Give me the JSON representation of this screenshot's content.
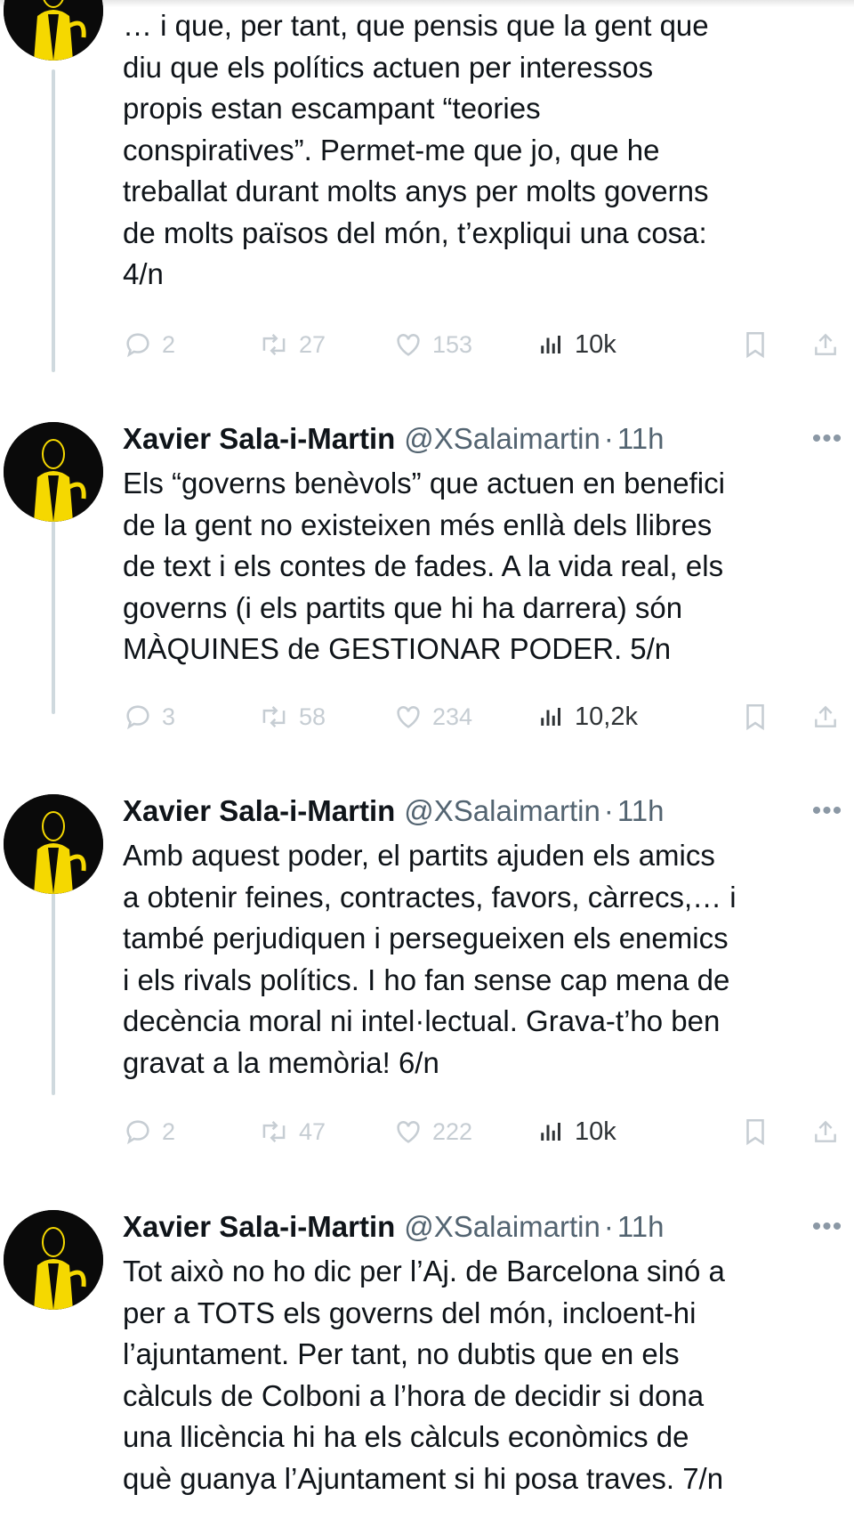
{
  "author": {
    "name": "Xavier Sala-i-Martin",
    "handle": "@XSalaimartin",
    "separator": "·",
    "time": "11h"
  },
  "colors": {
    "avatar_background": "#0a0a0a",
    "avatar_jacket": "#f5d800",
    "muted_text": "#536471",
    "faded_icon": "#c6cdd3",
    "thread_line": "#cfd9de"
  },
  "more_label": "•••",
  "tweets": [
    {
      "show_header": false,
      "text": "… i que, per tant, que pensis que la gent que\ndiu que els polítics actuen per interessos\npropis estan escampant “teories\nconspiratives”. Permet-me que jo, que he\ntreballat durant molts anys per molts governs\nde molts països del món, t’expliqui una cosa:\n4/n",
      "replies": "2",
      "reposts": "27",
      "likes": "153",
      "views": "10k"
    },
    {
      "show_header": true,
      "text": "Els “governs benèvols” que actuen en benefici\nde la gent no existeixen més enllà dels llibres\nde text i els contes de fades. A la vida real, els\ngoverns (i els partits que hi ha darrera) són\nMÀQUINES de GESTIONAR PODER. 5/n",
      "replies": "3",
      "reposts": "58",
      "likes": "234",
      "views": "10,2k"
    },
    {
      "show_header": true,
      "text": "Amb aquest poder, el partits ajuden els amics\na obtenir feines, contractes, favors, càrrecs,… i\ntambé perjudiquen i persegueixen els enemics\ni els rivals polítics. I ho fan sense cap mena de\ndecència moral ni intel·lectual. Grava-t’ho ben\ngravat a la memòria! 6/n",
      "replies": "2",
      "reposts": "47",
      "likes": "222",
      "views": "10k"
    },
    {
      "show_header": true,
      "text": "Tot això no ho dic per l’Aj. de Barcelona sinó a\nper a TOTS els governs del món, incloent-hi\nl’ajuntament. Per tant, no dubtis que en els\ncàlculs de Colboni a l’hora de decidir si dona\nuna llicència hi ha els càlculs econòmics de\nquè guanya l’Ajuntament si hi posa traves. 7/n"
    }
  ]
}
